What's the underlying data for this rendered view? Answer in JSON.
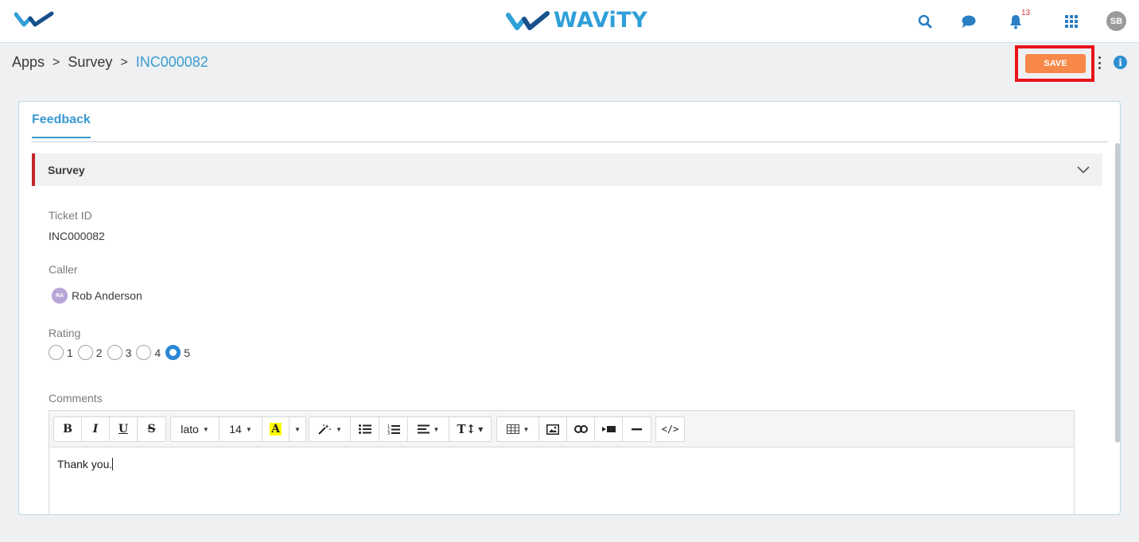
{
  "app": {
    "brand": "WAViTY",
    "notification_count": "13",
    "user_initials": "SB"
  },
  "breadcrumb": {
    "items": [
      "Apps",
      "Survey"
    ],
    "separator": ">",
    "current": "INC000082"
  },
  "actions": {
    "save_label": "SAVE"
  },
  "tabs": [
    {
      "label": "Feedback",
      "active": true
    }
  ],
  "section": {
    "title": "Survey",
    "expanded": true
  },
  "fields": {
    "ticket_id": {
      "label": "Ticket ID",
      "value": "INC000082"
    },
    "caller": {
      "label": "Caller",
      "initials": "RA",
      "name": "Rob Anderson"
    },
    "rating": {
      "label": "Rating",
      "options": [
        "1",
        "2",
        "3",
        "4",
        "5"
      ],
      "selected": "5"
    },
    "comments": {
      "label": "Comments",
      "value": "Thank you."
    }
  },
  "editor_toolbar": {
    "font_family": "lato",
    "font_size": "14",
    "highlight_glyph": "A"
  },
  "colors": {
    "accent": "#3a9ad0",
    "save": "#f7884a",
    "highlight_box": "#e8141b",
    "section_marker": "#c0272d"
  }
}
